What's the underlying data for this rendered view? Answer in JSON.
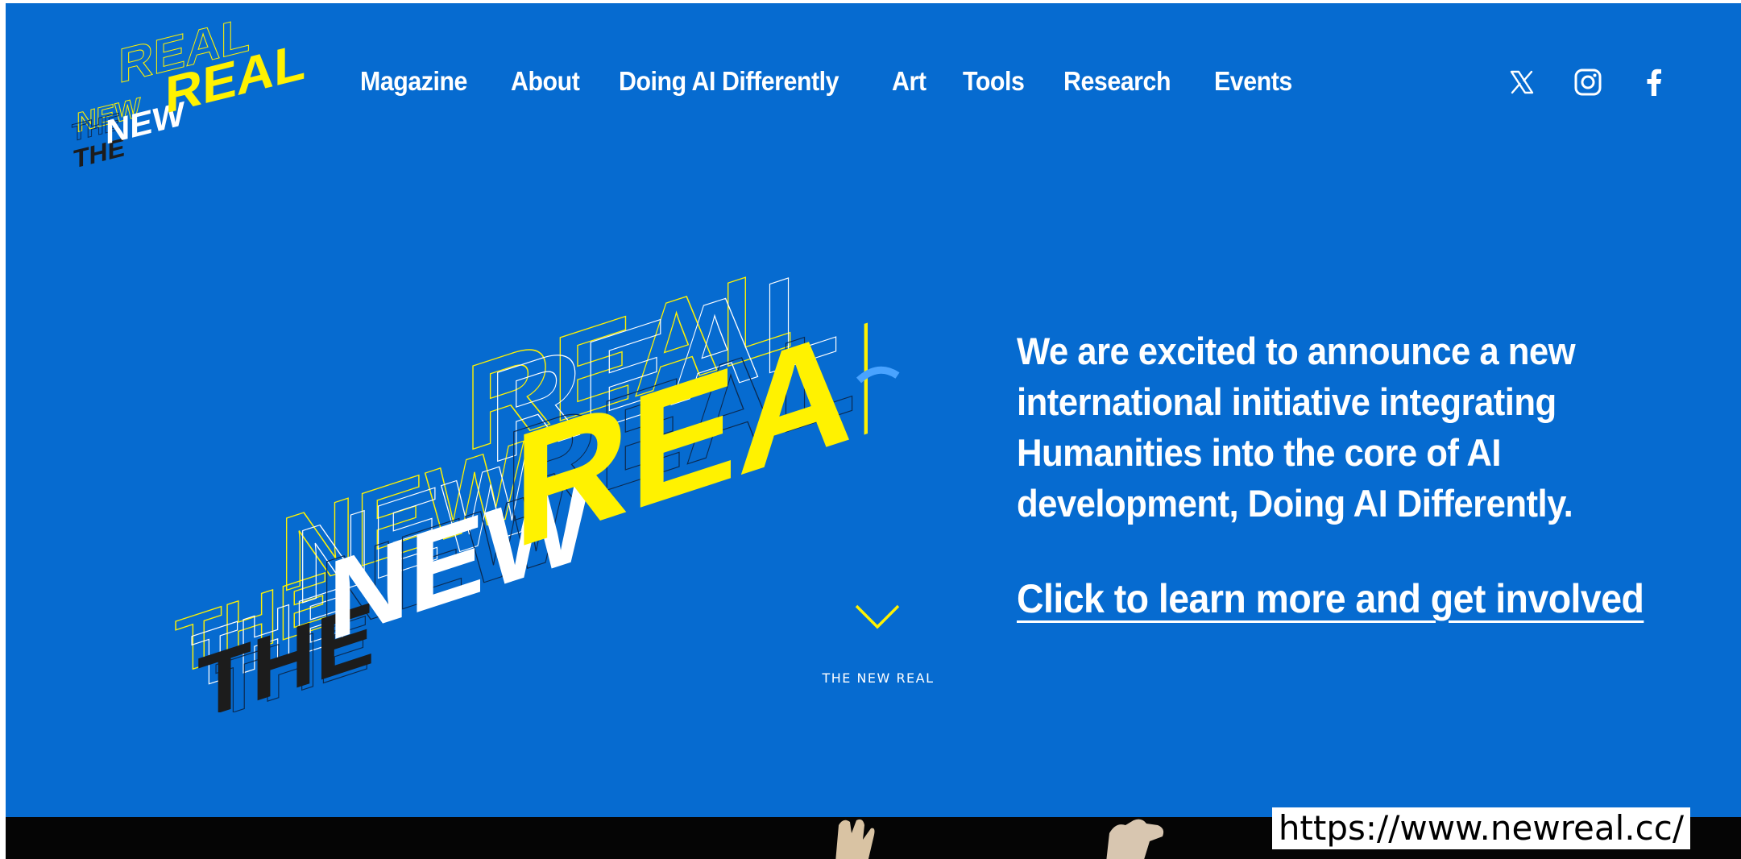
{
  "logo": {
    "word_the": "THE",
    "word_new": "NEW",
    "word_real": "REAL"
  },
  "nav": {
    "items": [
      "Magazine",
      "About",
      "Doing AI Differently",
      "Art",
      "Tools",
      "Research",
      "Events"
    ]
  },
  "social": [
    "x-icon",
    "instagram-icon",
    "facebook-icon"
  ],
  "hero": {
    "announcement": "We are excited to announce a new international initiative integrating Humanities into the core of AI development, Doing AI Differently.",
    "cta": "Click to learn more and get involved",
    "scroll_label": "THE NEW REAL"
  },
  "footer": {
    "url": "https://www.newreal.cc/"
  },
  "colors": {
    "background": "#066bd0",
    "accent_yellow": "#fff200",
    "text": "#ffffff",
    "dark": "#1c1c1c"
  }
}
